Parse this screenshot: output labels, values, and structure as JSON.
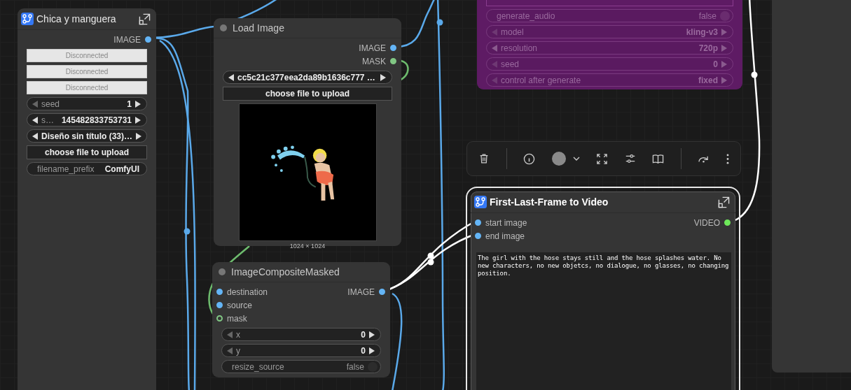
{
  "nodes": [
    {
      "kind": "subgraph",
      "title": "Chica y manguera",
      "selected": false,
      "bypassed": false,
      "outputs": [
        {
          "label": "IMAGE",
          "color": "#64b5f6"
        }
      ],
      "widgets": [
        {
          "kind": "disconnected",
          "label": "Disconnected"
        },
        {
          "kind": "disconnected",
          "label": "Disconnected"
        },
        {
          "kind": "disconnected",
          "label": "Disconnected"
        },
        {
          "kind": "stepper",
          "label": "seed",
          "value": "1",
          "decrement_disabled": true
        },
        {
          "kind": "stepper",
          "label": "s…",
          "value": "145482833753731",
          "decrement_disabled": false
        },
        {
          "kind": "stepper",
          "value": "Diseño sin título (33)…",
          "decrement_disabled": false
        },
        {
          "kind": "button",
          "label": "choose file to upload"
        },
        {
          "kind": "text",
          "label": "filename_prefix",
          "value": "ComfyUI"
        }
      ]
    },
    {
      "kind": "node",
      "title": "Load Image",
      "selected": false,
      "bypassed": false,
      "outputs": [
        {
          "label": "IMAGE",
          "color": "#64b5f6"
        },
        {
          "label": "MASK",
          "color": "#81c784"
        }
      ],
      "widgets": [
        {
          "kind": "stepper",
          "value": "cc5c21c377eea2da89b1636c777 …",
          "decrement_disabled": false
        },
        {
          "kind": "button",
          "label": "choose file to upload"
        },
        {
          "kind": "image",
          "caption": "1024 × 1024"
        }
      ]
    },
    {
      "kind": "node",
      "selected": false,
      "bypassed": true,
      "widgets": [
        {
          "kind": "toggle",
          "label": "generate_audio",
          "value": "false",
          "on": false
        },
        {
          "kind": "stepper",
          "label": "model",
          "value": "kling-v3",
          "decrement_disabled": true
        },
        {
          "kind": "stepper",
          "label": "resolution",
          "value": "720p",
          "decrement_disabled": false
        },
        {
          "kind": "stepper",
          "label": "seed",
          "value": "0",
          "decrement_disabled": true
        },
        {
          "kind": "stepper",
          "label": "control after generate",
          "value": "fixed",
          "decrement_disabled": true
        }
      ]
    },
    {
      "kind": "node",
      "title": "ImageCompositeMasked",
      "selected": false,
      "bypassed": false,
      "inputs": [
        {
          "label": "destination",
          "color": "#64b5f6",
          "connected": true
        },
        {
          "label": "source",
          "color": "#64b5f6",
          "connected": true
        },
        {
          "label": "mask",
          "color": "#81c784",
          "connected": false
        }
      ],
      "outputs": [
        {
          "label": "IMAGE",
          "color": "#64b5f6"
        }
      ],
      "widgets": [
        {
          "kind": "stepper",
          "label": "x",
          "value": "0",
          "decrement_disabled": true
        },
        {
          "kind": "stepper",
          "label": "y",
          "value": "0",
          "decrement_disabled": true
        },
        {
          "kind": "toggle",
          "label": "resize_source",
          "value": "false",
          "on": false
        }
      ]
    },
    {
      "kind": "subgraph",
      "title": "First-Last-Frame to Video",
      "selected": true,
      "bypassed": false,
      "inputs": [
        {
          "label": "start image",
          "color": "#64b5f6",
          "connected": true
        },
        {
          "label": "end image",
          "color": "#64b5f6",
          "connected": true
        }
      ],
      "outputs": [
        {
          "label": "VIDEO",
          "color": "#6ee85a"
        }
      ],
      "widgets": [
        {
          "kind": "textarea",
          "value": "The girl with the hose stays still and the hose splashes water. No new characters, no new objetcs, no dialogue, no glasses, no changing position."
        }
      ]
    }
  ]
}
